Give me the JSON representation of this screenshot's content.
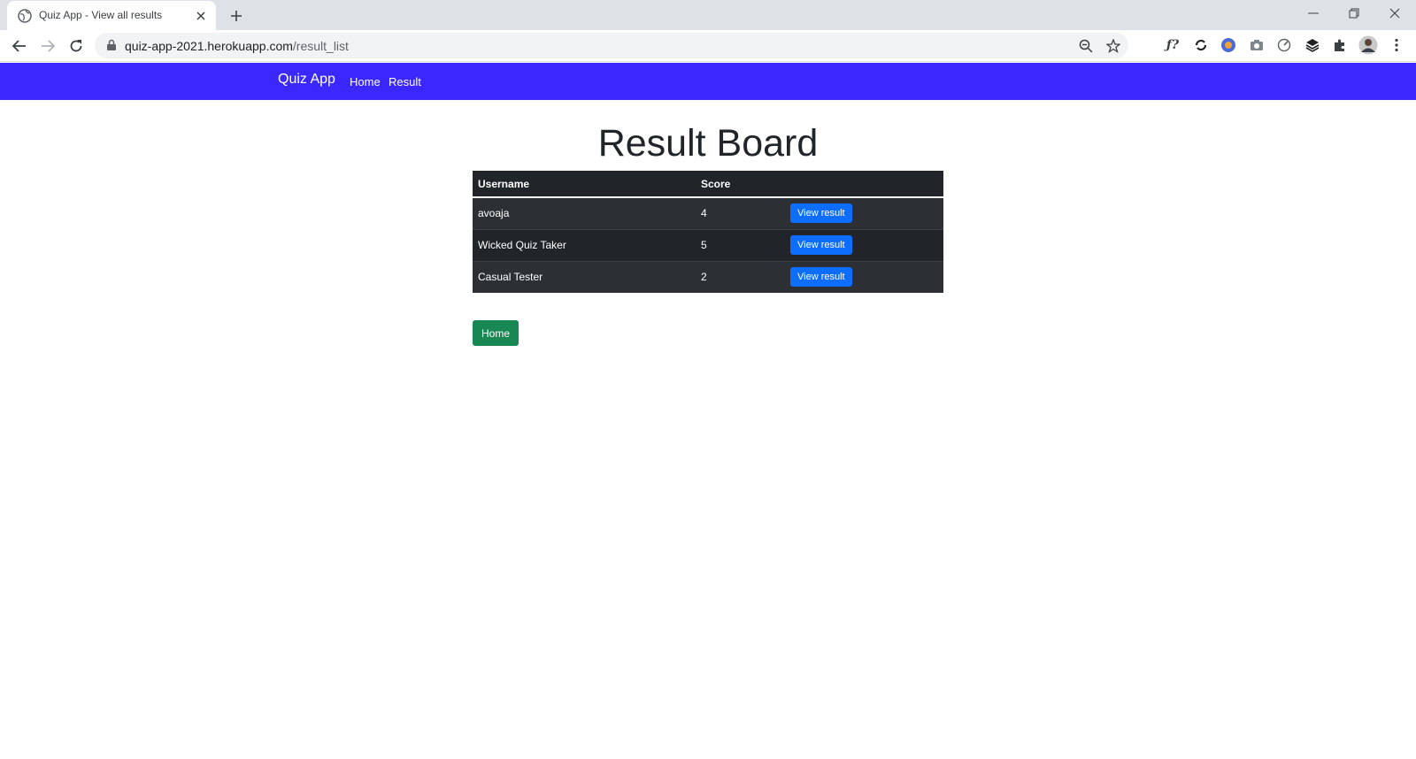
{
  "browser": {
    "tab_title": "Quiz App - View all results",
    "url_host": "quiz-app-2021.herokuapp.com",
    "url_path": "/result_list",
    "extensions": [
      "zoom-icon",
      "star-icon",
      "fx-extension-icon",
      "sync-extension-icon",
      "vpn-extension-icon",
      "camera-extension-icon",
      "speed-extension-icon",
      "layers-extension-icon",
      "puzzle-icon",
      "profile-avatar",
      "menu-icon"
    ]
  },
  "navbar": {
    "brand": "Quiz App",
    "links": [
      "Home",
      "Result"
    ],
    "color": "#3a28ff"
  },
  "main": {
    "title": "Result Board",
    "table": {
      "headers": [
        "Username",
        "Score",
        ""
      ],
      "rows": [
        {
          "username": "avoaja",
          "score": "4",
          "action": "View result"
        },
        {
          "username": "Wicked Quiz Taker",
          "score": "5",
          "action": "View result"
        },
        {
          "username": "Casual Tester",
          "score": "2",
          "action": "View result"
        }
      ]
    },
    "home_button": "Home"
  },
  "colors": {
    "table_dark": "#212529",
    "button_primary": "#0d6efd",
    "button_success": "#198754"
  }
}
